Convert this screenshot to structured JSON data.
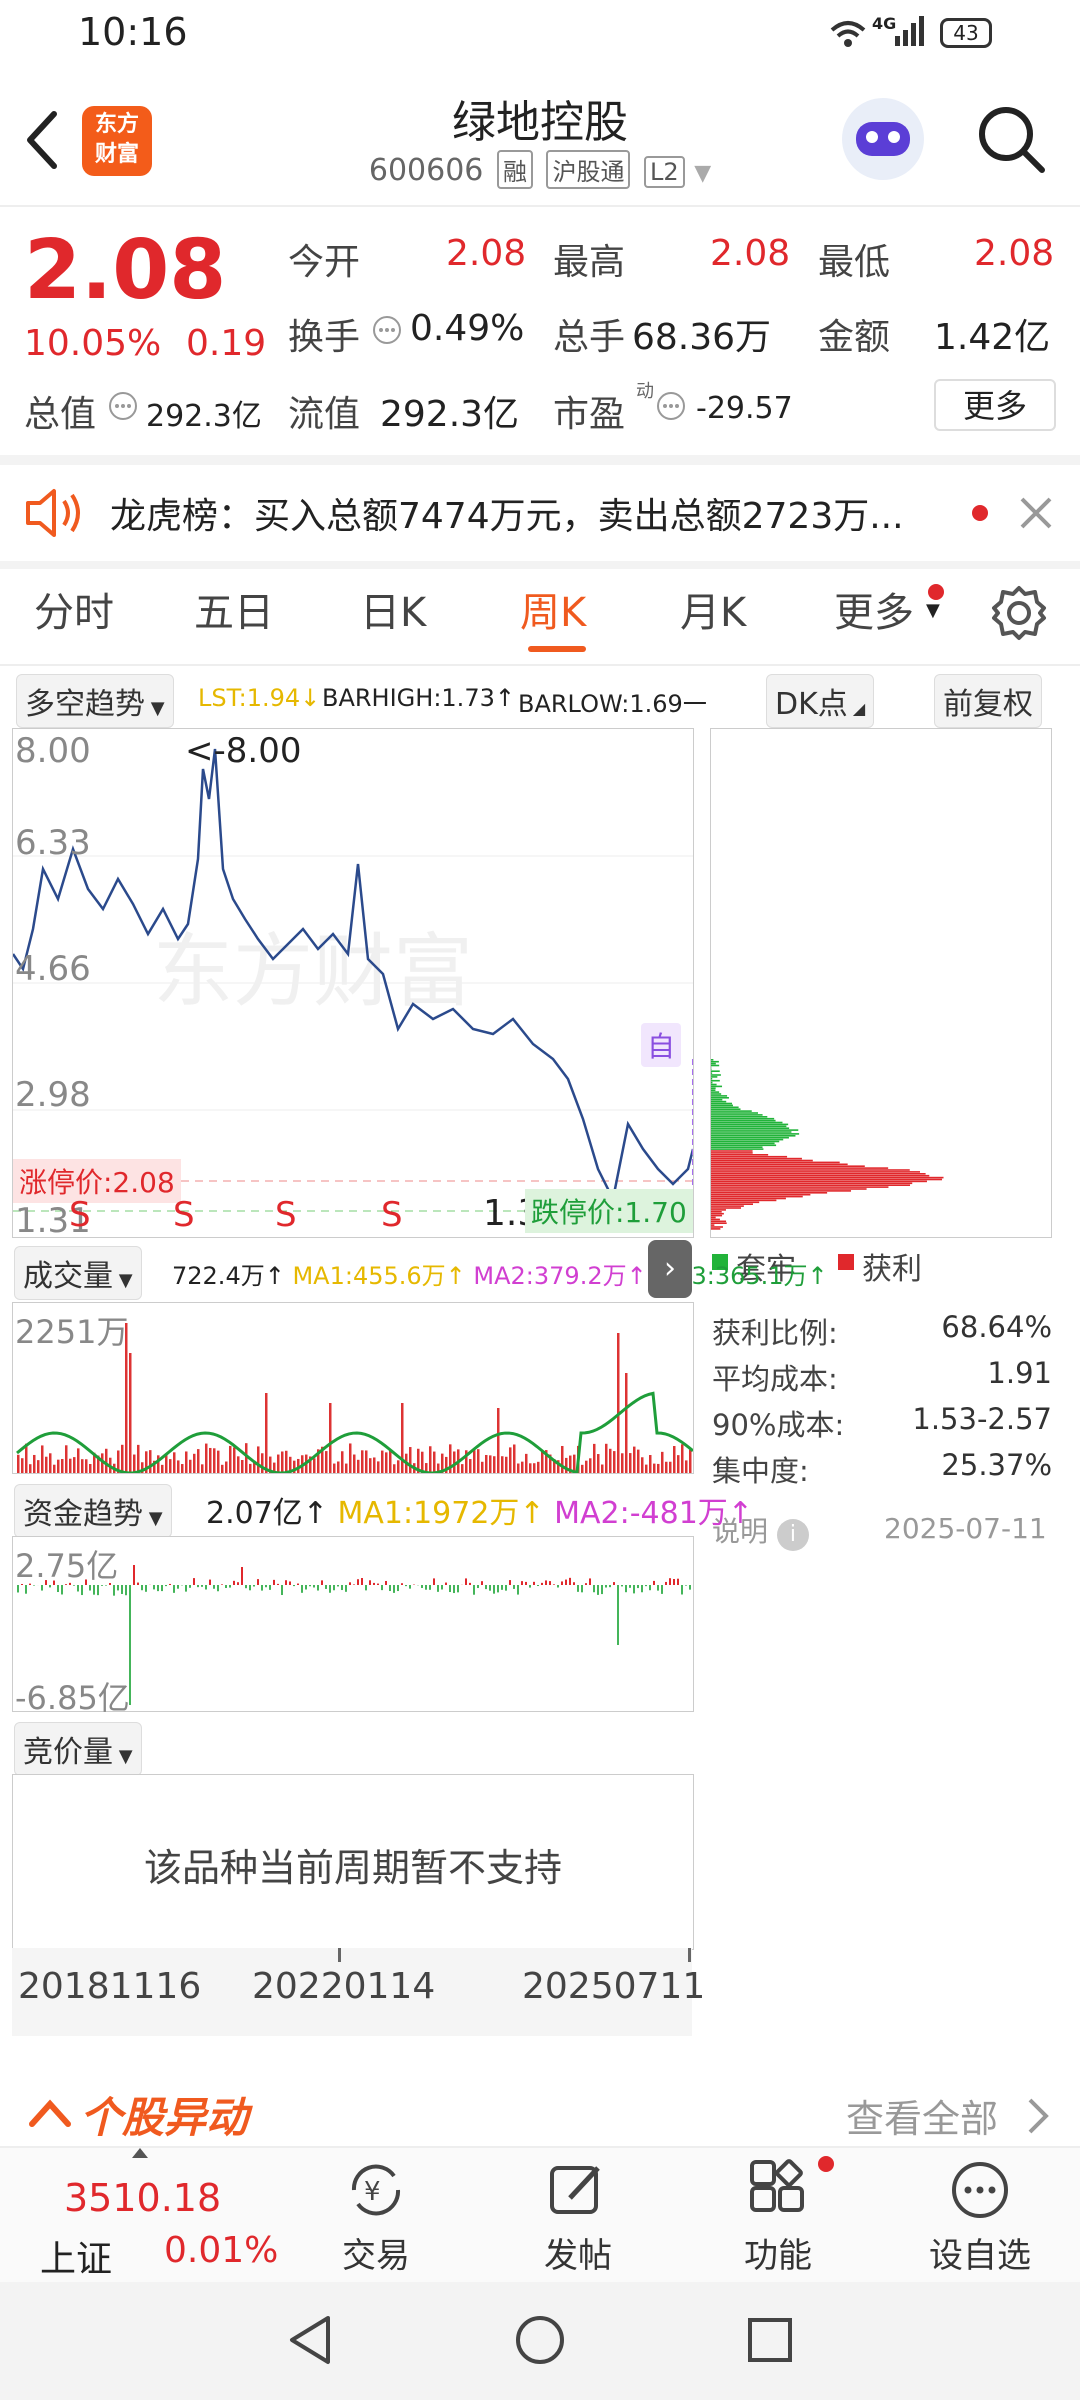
{
  "status_bar": {
    "time": "10:16",
    "battery": "43",
    "network": "4G"
  },
  "header": {
    "back_icon": "chevron-left-icon",
    "logo_lines": [
      "东方",
      "财富"
    ],
    "stock_name": "绿地控股",
    "code": "600606",
    "tags": [
      "融",
      "沪股通",
      "L2"
    ],
    "search_icon": "search-icon"
  },
  "quote": {
    "price": "2.08",
    "change_pct": "10.05%",
    "change": "0.19",
    "open_label": "今开",
    "open": "2.08",
    "high_label": "最高",
    "high": "2.08",
    "low_label": "最低",
    "low": "2.08",
    "turnover_label": "换手",
    "turnover": "0.49%",
    "volume_label": "总手",
    "volume": "68.36万",
    "amount_label": "金额",
    "amount": "1.42亿",
    "mktcap_label": "总值",
    "mktcap": "292.3亿",
    "float_label": "流值",
    "float": "292.3亿",
    "pe_label": "市盈",
    "pe_sup": "动",
    "pe": "-29.57",
    "more_label": "更多"
  },
  "notice": {
    "text": "龙虎榜：买入总额7474万元，卖出总额2723万..."
  },
  "tabs": [
    "分时",
    "五日",
    "日K",
    "周K",
    "月K",
    "更多"
  ],
  "active_tab": "周K",
  "kline": {
    "indicator_label": "多空趋势",
    "lst": "LST:1.94↓",
    "barhigh": "BARHIGH:1.73↑",
    "barlow": "BARLOW:1.69一",
    "dk_label": "DK点",
    "fq_label": "前复权",
    "y_ticks": [
      "8.00",
      "6.33",
      "4.66",
      "2.98",
      "1.31"
    ],
    "max_label": "<-8.00",
    "min_label": "1.31",
    "limit_up": "涨停价:2.08",
    "limit_down": "跌停价:1.70",
    "auto_label": "自",
    "markers": [
      "S",
      "S",
      "S",
      "S"
    ],
    "watermark": "东方财富"
  },
  "volume": {
    "label": "成交量",
    "value": "722.4万↑",
    "ma1": "MA1:455.6万↑",
    "ma2": "MA2:379.2万↑",
    "ma3": "MA3:365.1万↑",
    "ytop": "2251万"
  },
  "fund": {
    "label": "资金趋势",
    "value": "2.07亿↑",
    "ma1": "MA1:1972万↑",
    "ma2": "MA2:-481万↑",
    "ytop": "2.75亿",
    "ybottom": "-6.85亿"
  },
  "auction": {
    "label": "竞价量",
    "message": "该品种当前周期暂不支持"
  },
  "dates": [
    "20181116",
    "20220114",
    "20250711"
  ],
  "cost": {
    "legend_trapped": "套牢",
    "legend_profit": "获利",
    "rows": [
      {
        "label": "获利比例:",
        "value": "68.64%"
      },
      {
        "label": "平均成本:",
        "value": "1.91"
      },
      {
        "label": "90%成本:",
        "value": "1.53-2.57"
      },
      {
        "label": "集中度:",
        "value": "25.37%"
      }
    ],
    "note_label": "说明",
    "date": "2025-07-11"
  },
  "movement": {
    "title": "个股异动",
    "view_all": "查看全部"
  },
  "bottom_nav": {
    "index_value": "3510.18",
    "index_name": "上证",
    "index_change": "0.01%",
    "items": [
      "交易",
      "发帖",
      "功能",
      "设自选"
    ]
  },
  "colors": {
    "up": "#e0282c",
    "down": "#1f9e3a",
    "accent": "#f05a1f",
    "line": "#2b4a8c"
  }
}
